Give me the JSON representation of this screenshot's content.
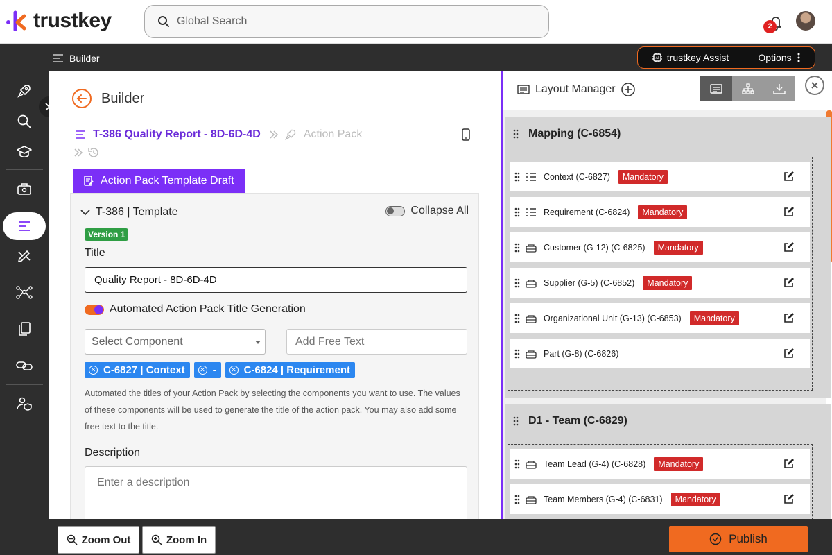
{
  "app": {
    "brand": "trustkey"
  },
  "search": {
    "placeholder": "Global Search"
  },
  "notifications": {
    "count": "2"
  },
  "subbar": {
    "title": "Builder",
    "assist_label": "trustkey Assist",
    "options_label": "Options"
  },
  "builder": {
    "page_title": "Builder",
    "breadcrumb_main": "T-386 Quality Report - 8D-6D-4D",
    "breadcrumb_sec": "Action Pack",
    "draft_tab": "Action Pack Template Draft",
    "template_header": "T-386 | Template",
    "collapse_all": "Collapse All",
    "version": "Version 1",
    "title_label": "Title",
    "title_value": "Quality Report - 8D-6D-4D",
    "auto_title_label": "Automated Action Pack Title Generation",
    "select_component_placeholder": "Select Component",
    "free_text_placeholder": "Add Free Text",
    "chips": [
      "C-6827 | Context",
      "-",
      "C-6824 | Requirement"
    ],
    "help_text": "Automated the titles of your Action Pack by selecting the components you want to use. The values of these components will be used to generate the title of the action pack. You may also add some free text to the title.",
    "description_label": "Description",
    "description_placeholder": "Enter a description"
  },
  "layout_manager": {
    "title": "Layout Manager",
    "sections": [
      {
        "title": "Mapping (C-6854)",
        "rows": [
          {
            "icon": "list-icon",
            "label": "Context (C-6827)",
            "badge": "Mandatory"
          },
          {
            "icon": "list-icon",
            "label": "Requirement (C-6824)",
            "badge": "Mandatory"
          },
          {
            "icon": "group-icon",
            "label": "Customer (G-12) (C-6825)",
            "badge": "Mandatory"
          },
          {
            "icon": "group-icon",
            "label": "Supplier (G-5) (C-6852)",
            "badge": "Mandatory"
          },
          {
            "icon": "group-icon",
            "label": "Organizational Unit (G-13) (C-6853)",
            "badge": "Mandatory"
          },
          {
            "icon": "group-icon",
            "label": "Part (G-8) (C-6826)",
            "badge": ""
          }
        ]
      },
      {
        "title": "D1 - Team (C-6829)",
        "rows": [
          {
            "icon": "group-icon",
            "label": "Team Lead (G-4) (C-6828)",
            "badge": "Mandatory"
          },
          {
            "icon": "group-icon",
            "label": "Team Members (G-4) (C-6831)",
            "badge": "Mandatory"
          }
        ]
      }
    ]
  },
  "footer": {
    "zoom_out": "Zoom Out",
    "zoom_in": "Zoom In",
    "publish": "Publish"
  },
  "colors": {
    "accent_purple": "#7b2ff7",
    "accent_orange": "#f06a20",
    "mandatory_red": "#d12a2a",
    "chip_blue": "#2c87f0"
  }
}
